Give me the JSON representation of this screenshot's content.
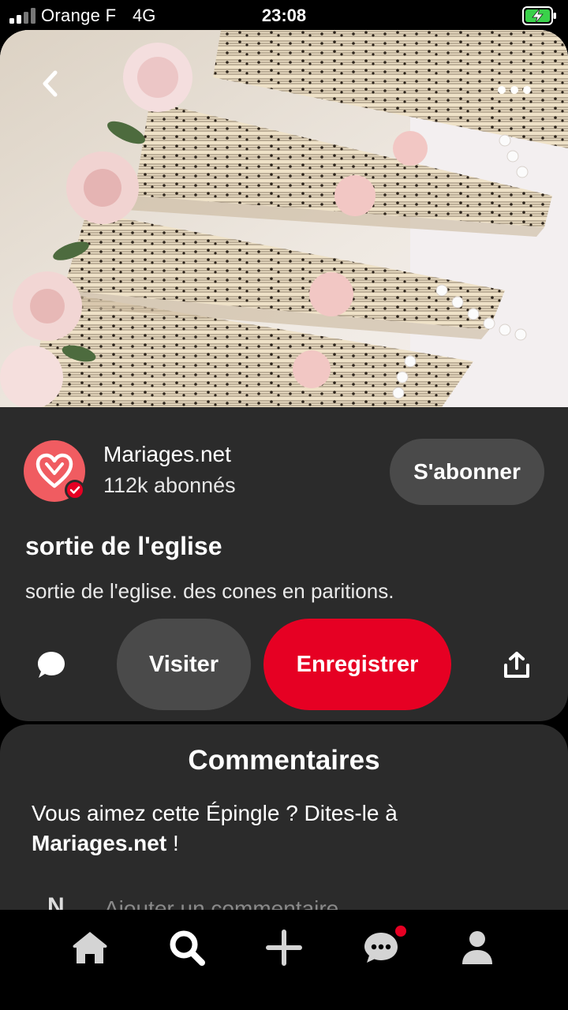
{
  "status_bar": {
    "carrier": "Orange F",
    "network": "4G",
    "time": "23:08"
  },
  "pin": {
    "image_icon": "sheet-music-cones-photo",
    "author": {
      "name": "Mariages.net",
      "followers": "112k abonnés",
      "follow_label": "S'abonner"
    },
    "title": "sortie de l'eglise",
    "description": "sortie de l'eglise. des cones en paritions.",
    "actions": {
      "visit_label": "Visiter",
      "save_label": "Enregistrer"
    }
  },
  "comments": {
    "title": "Commentaires",
    "prompt_text": "Vous aimez cette Épingle ? Dites-le à",
    "prompt_author": "Mariages.net",
    "prompt_suffix": " !",
    "avatar_letter": "N",
    "input_placeholder": "Ajouter un commentaire"
  },
  "bottom_nav": {
    "items": [
      "home-icon",
      "search-icon",
      "plus-icon",
      "messages-icon",
      "profile-icon"
    ]
  },
  "colors": {
    "accent": "#e60023",
    "card": "#2b2b2b",
    "avatar": "#f05c61"
  }
}
